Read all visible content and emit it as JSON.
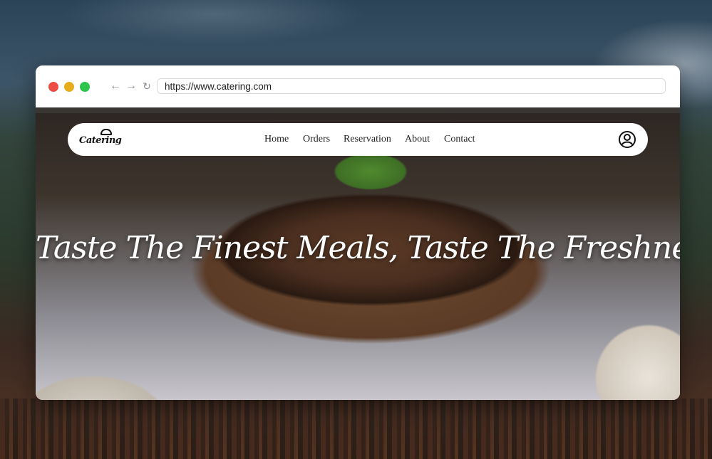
{
  "browser": {
    "url": "https://www.catering.com"
  },
  "site": {
    "logo_text": "Catering",
    "nav": [
      {
        "label": "Home"
      },
      {
        "label": "Orders"
      },
      {
        "label": "Reservation"
      },
      {
        "label": "About"
      },
      {
        "label": "Contact"
      }
    ],
    "hero_title": "Taste The Finest Meals, Taste The Freshness"
  },
  "colors": {
    "traffic_red": "#ed4c45",
    "traffic_yellow": "#e5ad1b",
    "traffic_green": "#2cc44a"
  },
  "icons": {
    "back": "arrow-left-icon",
    "forward": "arrow-right-icon",
    "reload": "reload-icon",
    "user": "user-account-icon"
  }
}
